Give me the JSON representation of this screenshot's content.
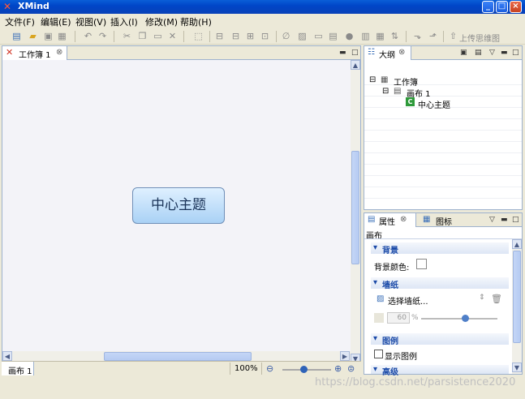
{
  "window": {
    "title": "XMind",
    "app_icon": "xmind-logo-icon"
  },
  "menu": [
    {
      "label": "文件(F)"
    },
    {
      "label": "编辑(E)"
    },
    {
      "label": "视图(V)"
    },
    {
      "label": "插入(I)"
    },
    {
      "label": "修改(M)"
    },
    {
      "label": "帮助(H)"
    }
  ],
  "toolbar": {
    "upload_label": "上传思维图"
  },
  "editor": {
    "tab_label": "工作簿 1",
    "central_topic": "中心主题",
    "sheet_tab": "画布 1",
    "zoom": "100%"
  },
  "outline": {
    "tab_label": "大纲",
    "tree": [
      {
        "label": "工作簿",
        "icon": "workbook-icon"
      },
      {
        "label": "画布 1",
        "icon": "sheet-icon"
      },
      {
        "label": "中心主题",
        "icon": "topic-icon"
      }
    ]
  },
  "properties": {
    "tab_label": "属性",
    "tab2_label": "图标",
    "panel_title": "画布",
    "sections": {
      "background": "背景",
      "background_color_label": "背景颜色:",
      "wallpaper": "墙纸",
      "choose_wallpaper": "选择墙纸...",
      "opacity_value": "60",
      "opacity_unit": "%",
      "legend": "图例",
      "show_legend": "显示图例",
      "advanced": "高级"
    }
  },
  "watermark": "https://blog.csdn.net/parsistence2020"
}
